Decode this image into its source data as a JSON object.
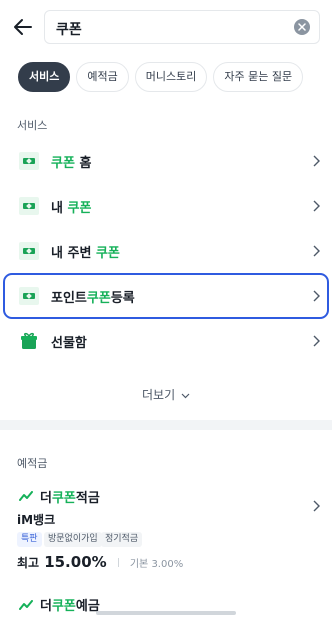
{
  "search": {
    "value": "쿠폰"
  },
  "filter_chips": [
    {
      "label": "서비스",
      "active": true
    },
    {
      "label": "예적금",
      "active": false
    },
    {
      "label": "머니스토리",
      "active": false
    },
    {
      "label": "자주 묻는 질문",
      "active": false
    }
  ],
  "services": {
    "section_label": "서비스",
    "items": [
      {
        "pre": "",
        "hl": "쿠폰",
        "post": " 홈",
        "icon": "ticket-icon"
      },
      {
        "pre": "내 ",
        "hl": "쿠폰",
        "post": "",
        "icon": "ticket-icon"
      },
      {
        "pre": "내 주변 ",
        "hl": "쿠폰",
        "post": "",
        "icon": "ticket-icon"
      },
      {
        "pre": "포인트",
        "hl": "쿠폰",
        "post": "등록",
        "icon": "ticket-icon"
      },
      {
        "pre": "선물함",
        "hl": "",
        "post": "",
        "icon": "gift-icon"
      }
    ],
    "more_label": "더보기"
  },
  "savings": {
    "section_label": "예적금",
    "products": [
      {
        "pre": "더",
        "hl": "쿠폰",
        "post": "적금",
        "bank": "iM뱅크",
        "badges": [
          "특판",
          "방문없이가입",
          "정기적금"
        ],
        "rate_prefix": "최고",
        "rate_value": "15.00%",
        "base_rate": "기본 3.00%"
      },
      {
        "pre": "더",
        "hl": "쿠폰",
        "post": "예금"
      }
    ]
  },
  "colors": {
    "accent": "#16b15a",
    "highlight_border": "#2f5be0",
    "chip_active": "#333d4b"
  }
}
